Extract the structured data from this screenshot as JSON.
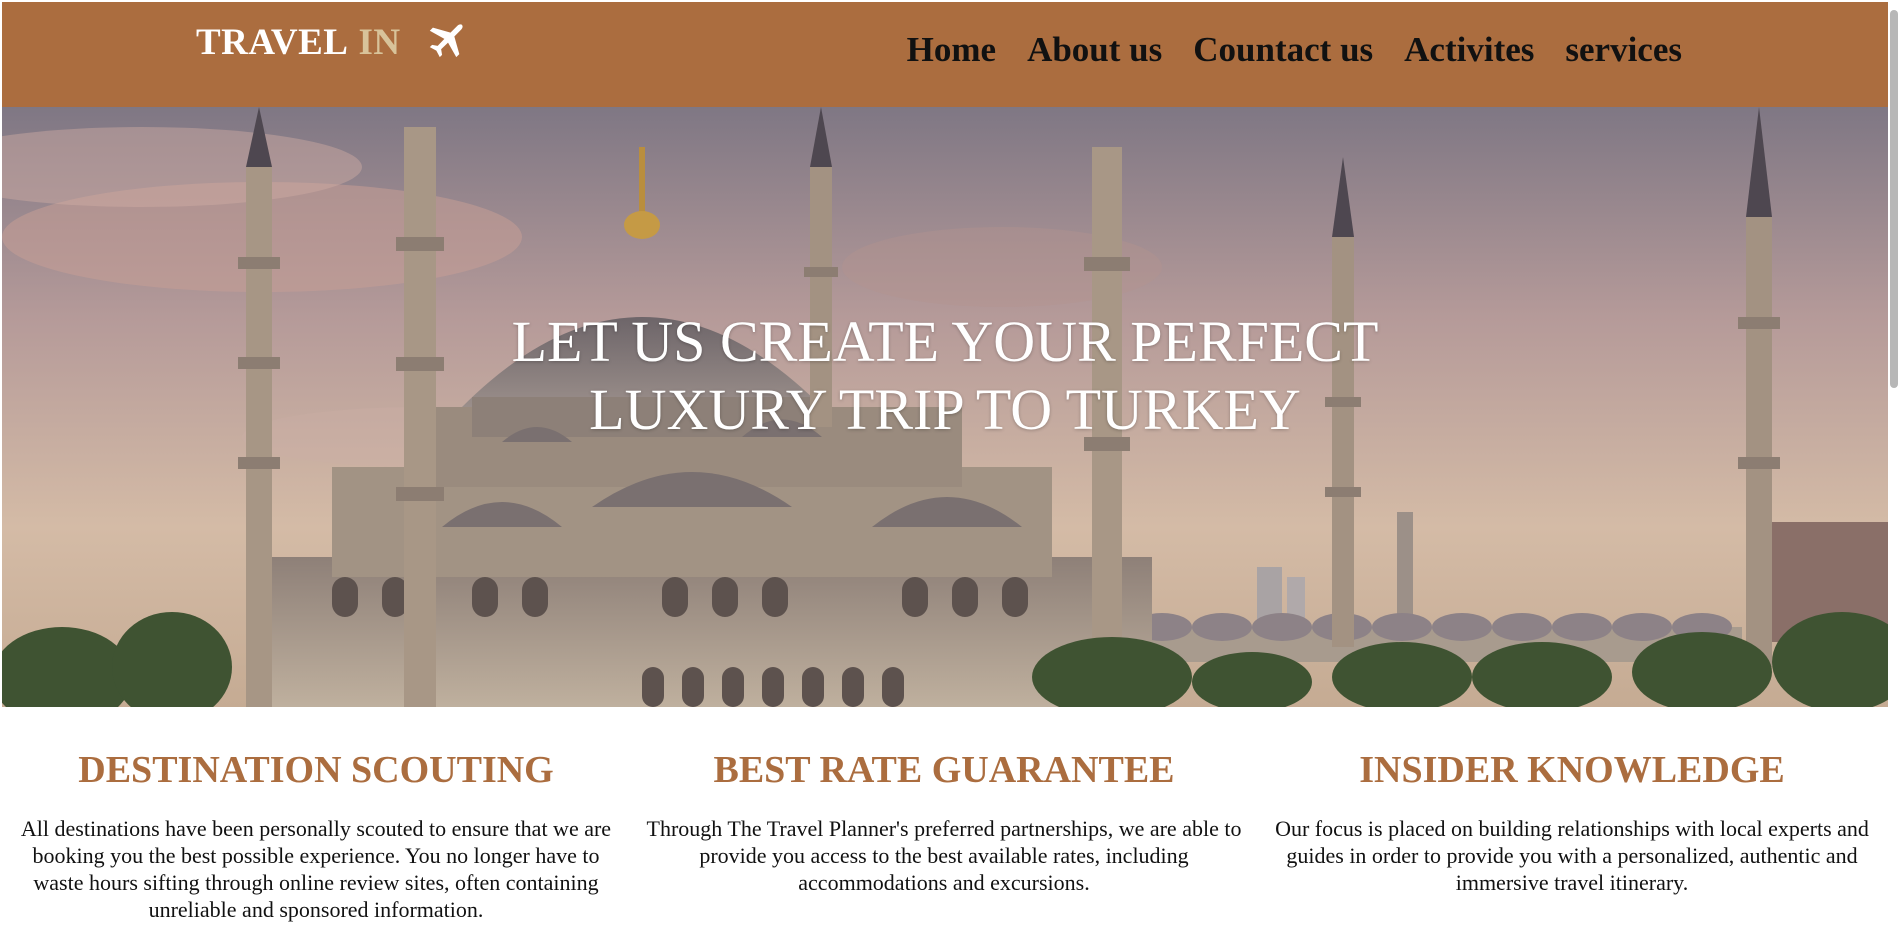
{
  "brand": {
    "word1": "TRAVEL",
    "word2": "IN",
    "icon": "airplane-icon"
  },
  "nav": {
    "items": [
      {
        "label": "Home"
      },
      {
        "label": "About us"
      },
      {
        "label": "Countact us"
      },
      {
        "label": "Activites"
      },
      {
        "label": "services"
      }
    ]
  },
  "hero": {
    "title_line1": "LET US CREATE YOUR PERFECT",
    "title_line2": "LUXURY TRIP TO TURKEY",
    "image": "Blue Mosque Istanbul at sunset"
  },
  "features": [
    {
      "title": "DESTINATION SCOUTING",
      "text": "All destinations have been personally scouted to ensure that we are booking you the best possible experience. You no longer have to waste hours sifting through online review sites, often containing unreliable and sponsored information."
    },
    {
      "title": "BEST RATE GUARANTEE",
      "text": "Through The Travel Planner's preferred partnerships, we are able to provide you access to the best available rates, including accommodations and excursions."
    },
    {
      "title": "INSIDER KNOWLEDGE",
      "text": "Our focus is placed on building relationships with local experts and guides in order to provide you with a personalized, authentic and immersive travel itinerary."
    }
  ],
  "colors": {
    "brand": "#ab6d3f",
    "brand_accent": "#d8c39a",
    "text": "#111111"
  }
}
